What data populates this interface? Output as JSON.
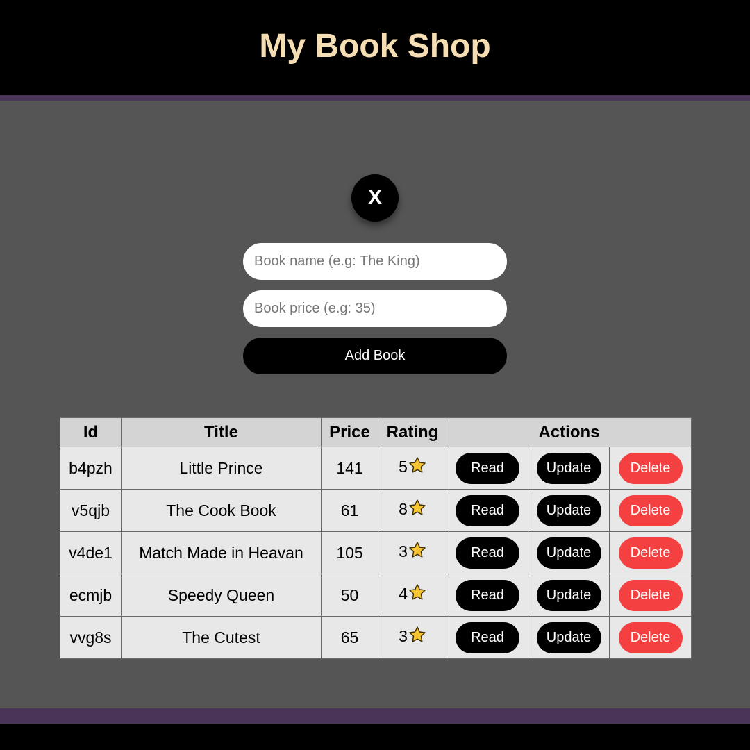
{
  "header": {
    "title": "My Book Shop"
  },
  "form": {
    "close_label": "X",
    "name_placeholder": "Book name (e.g: The King)",
    "price_placeholder": "Book price (e.g: 35)",
    "add_label": "Add Book"
  },
  "table": {
    "headers": [
      "Id",
      "Title",
      "Price",
      "Rating",
      "Actions"
    ],
    "rows": [
      {
        "id": "b4pzh",
        "title": "Little Prince",
        "price": "141",
        "rating": "5"
      },
      {
        "id": "v5qjb",
        "title": "The Cook Book",
        "price": "61",
        "rating": "8"
      },
      {
        "id": "v4de1",
        "title": "Match Made in Heavan",
        "price": "105",
        "rating": "3"
      },
      {
        "id": "ecmjb",
        "title": "Speedy Queen",
        "price": "50",
        "rating": "4"
      },
      {
        "id": "vvg8s",
        "title": "The Cutest",
        "price": "65",
        "rating": "3"
      }
    ],
    "actions": {
      "read": "Read",
      "update": "Update",
      "delete": "Delete"
    }
  },
  "colors": {
    "title": "#f5deb3",
    "accent_strip": "#4a3458",
    "background": "#555555",
    "delete": "#f44040",
    "star": "#f7c531"
  },
  "icons": {
    "rating": "star-icon",
    "close": "close-icon"
  }
}
